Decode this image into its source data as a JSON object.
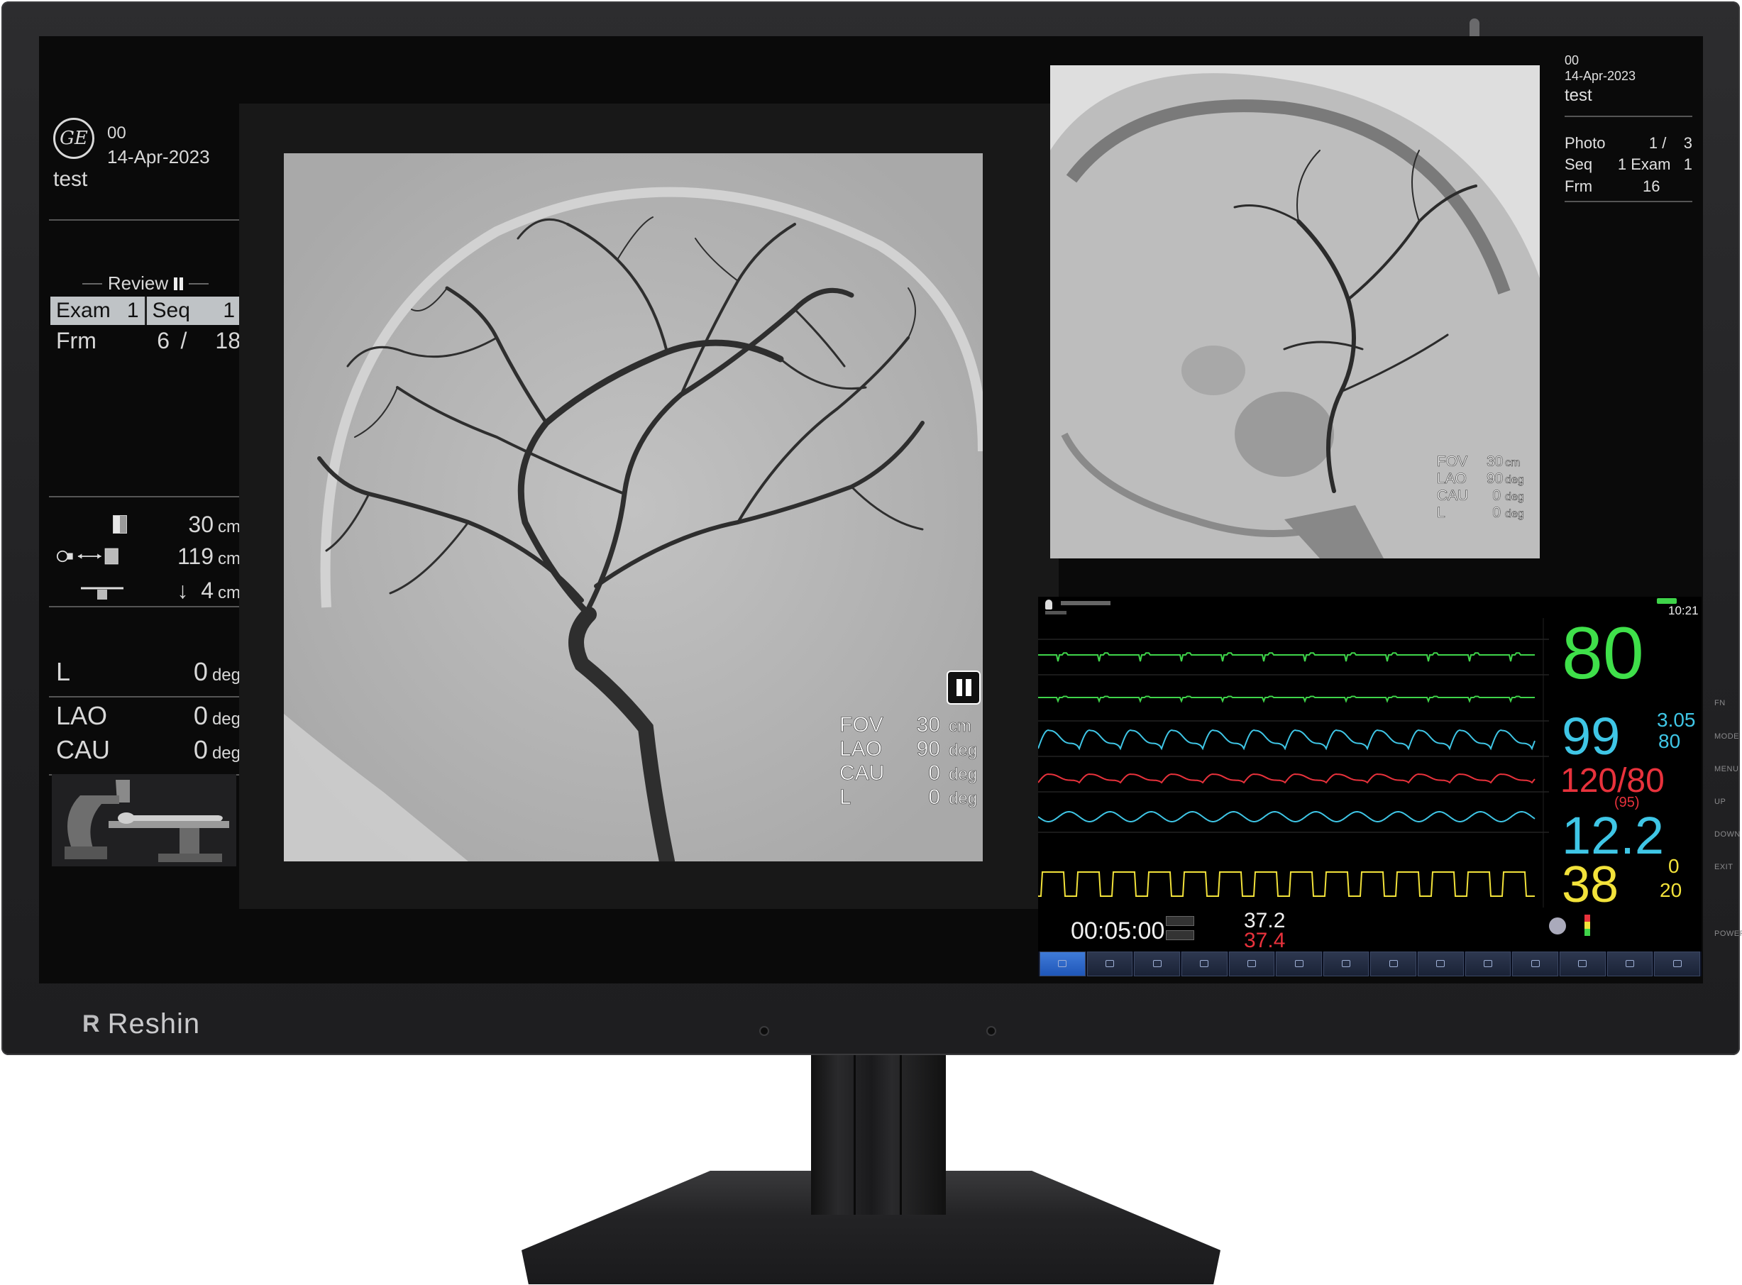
{
  "monitor": {
    "brand": "Reshin",
    "side_buttons": [
      "FN",
      "MODE",
      "MENU",
      "UP",
      "DOWN",
      "EXIT",
      "POWER"
    ]
  },
  "left_panel": {
    "logo": "ge-logo",
    "patient_id": "00",
    "date": "14-Apr-2023",
    "patient_name": "test",
    "review_label": "Review",
    "exam_label": "Exam",
    "exam_value": "1",
    "seq_label": "Seq",
    "seq_value": "1",
    "frm_label": "Frm",
    "frm_current": "6",
    "frm_sep": "/",
    "frm_total": "18",
    "geometry": [
      {
        "icon": "detector-icon",
        "value": "30",
        "unit": "cm"
      },
      {
        "icon": "sid-icon",
        "value": "119",
        "unit": "cm"
      },
      {
        "icon": "table-height-icon",
        "value": "4",
        "unit": "cm",
        "prefix": "↓"
      }
    ],
    "angles": [
      {
        "label": "L",
        "value": "0",
        "unit": "deg"
      },
      {
        "label": "LAO",
        "value": "0",
        "unit": "deg"
      },
      {
        "label": "CAU",
        "value": "0",
        "unit": "deg"
      }
    ]
  },
  "main_viewport": {
    "overlay": [
      {
        "label": "FOV",
        "value": "30",
        "unit": "cm"
      },
      {
        "label": "LAO",
        "value": "90",
        "unit": "deg"
      },
      {
        "label": "CAU",
        "value": "0",
        "unit": "deg"
      },
      {
        "label": "L",
        "value": "0",
        "unit": "deg"
      }
    ]
  },
  "secondary_viewport": {
    "patient_id": "00",
    "date": "14-Apr-2023",
    "patient_name": "test",
    "photo_label": "Photo",
    "photo_value": "1 /    3",
    "seq_label": "Seq",
    "seq_value": "1 Exam   1",
    "frm_label": "Frm",
    "frm_value": "16",
    "overlay": [
      {
        "label": "FOV",
        "value": "30",
        "unit": "cm"
      },
      {
        "label": "LAO",
        "value": "90",
        "unit": "deg"
      },
      {
        "label": "CAU",
        "value": "0",
        "unit": "deg"
      },
      {
        "label": "L",
        "value": "0",
        "unit": "deg"
      }
    ]
  },
  "patient_monitor": {
    "time": "10:21",
    "hr": "80",
    "spo2": "99",
    "pi_top": "3.05",
    "pi_bottom": "80",
    "nibp": "120/80",
    "nibp_map": "(95)",
    "cvp": "12.2",
    "resp": "38",
    "resp_top": "0",
    "resp_bottom": "20",
    "timer": "00:05:00",
    "temp1": "37.2",
    "temp2": "37.4",
    "colors": {
      "ecg": "#3fd44a",
      "spo2": "#3fc6e6",
      "nibp": "#e8323c",
      "resp": "#f2e23a",
      "hr_num": "#3fe04a"
    },
    "bottom_buttons": 14
  }
}
